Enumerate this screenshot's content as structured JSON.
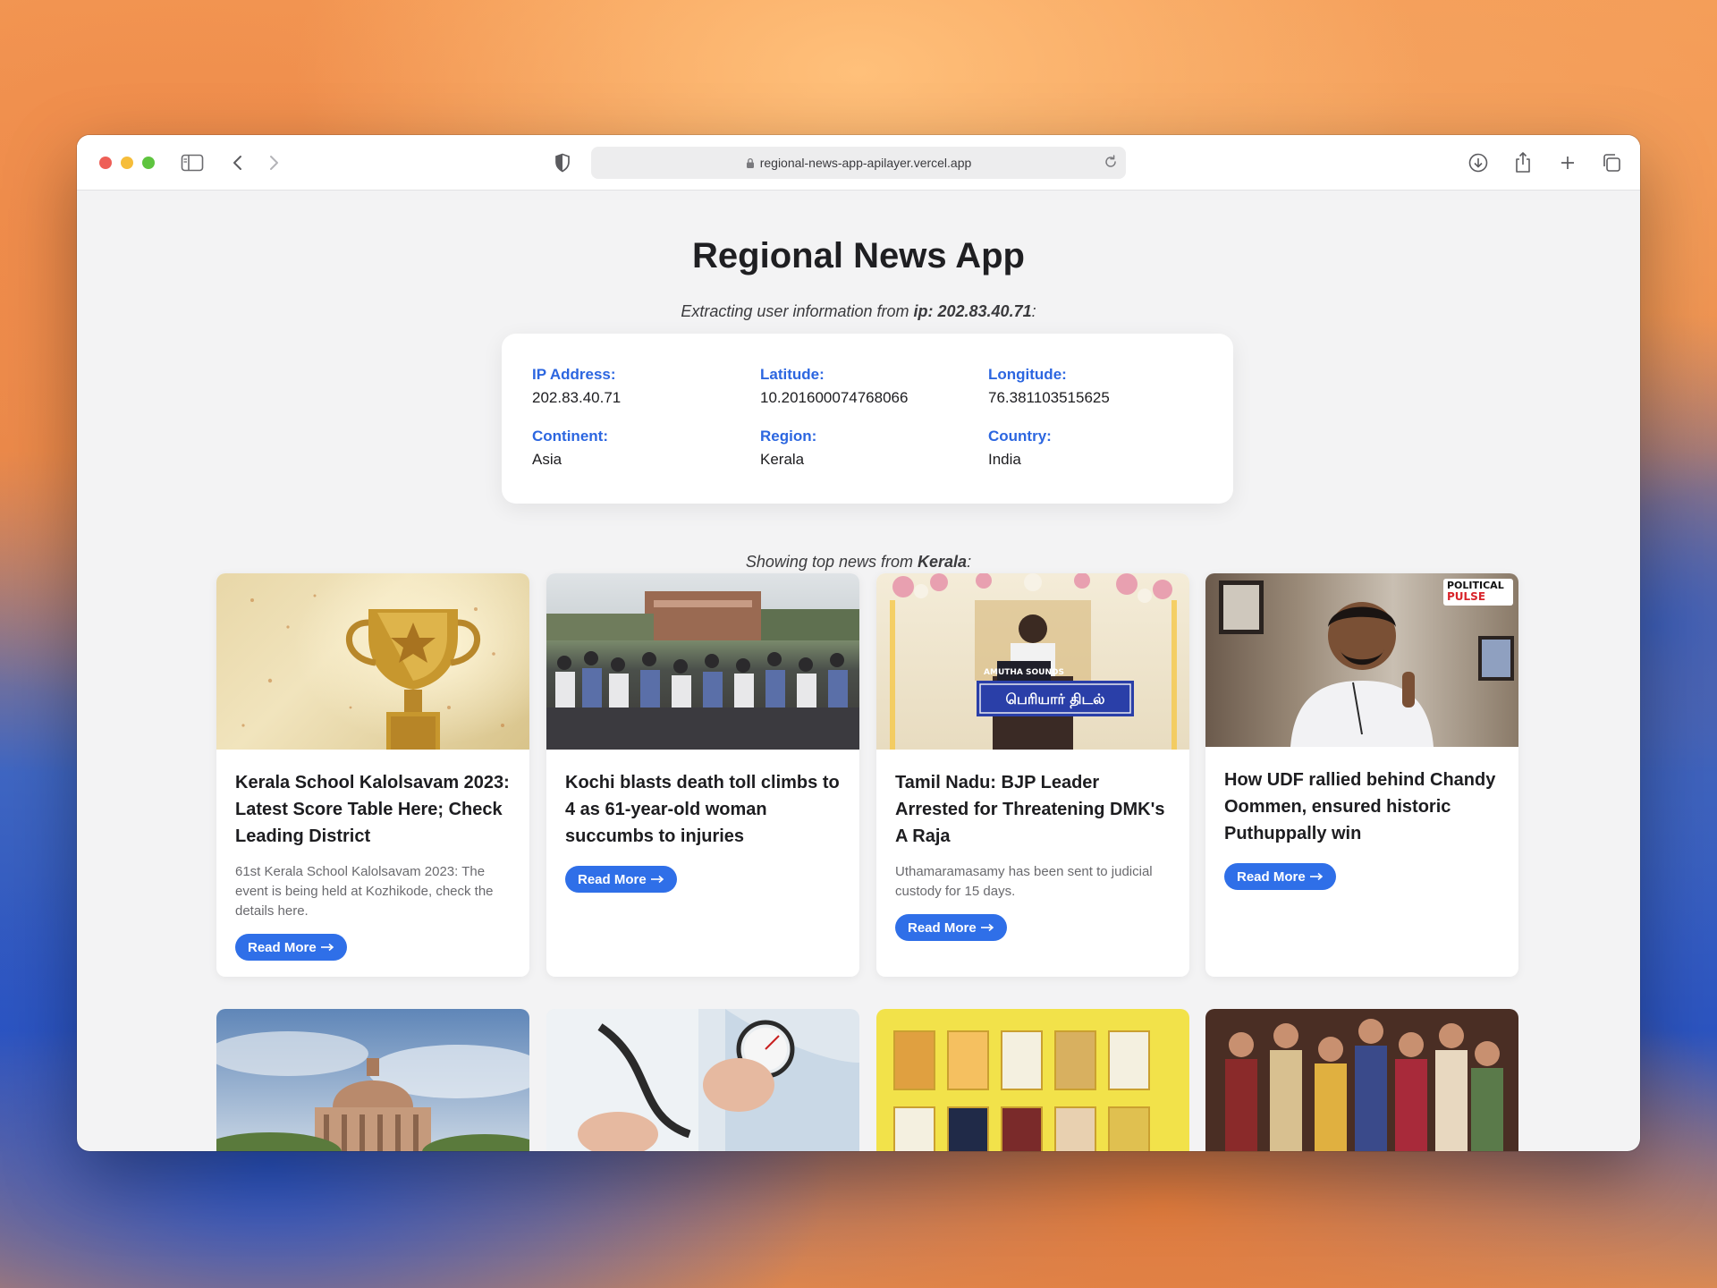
{
  "browser": {
    "url": "regional-news-app-apilayer.vercel.app"
  },
  "page": {
    "title": "Regional News App",
    "ip_intro": "Extracting user information from",
    "ip_label": "ip: 202.83.40.71",
    "ip_suffix": ":",
    "news_intro": "Showing top news from",
    "news_region": "Kerala",
    "news_suffix": ":"
  },
  "info": {
    "ip_label": "IP Address:",
    "ip_value": "202.83.40.71",
    "lat_label": "Latitude:",
    "lat_value": "10.201600074768066",
    "lon_label": "Longitude:",
    "lon_value": "76.381103515625",
    "continent_label": "Continent:",
    "continent_value": "Asia",
    "region_label": "Region:",
    "region_value": "Kerala",
    "country_label": "Country:",
    "country_value": "India"
  },
  "cards": [
    {
      "title": "Kerala School Kalolsavam 2023: Latest Score Table Here; Check Leading District",
      "desc": "61st Kerala School Kalolsavam 2023: The event is being held at Kozhikode, check the details here.",
      "button": "Read More",
      "image": "trophy-image"
    },
    {
      "title": "Kochi blasts death toll climbs to 4 as 61-year-old woman succumbs to injuries",
      "desc": "",
      "button": "Read More",
      "image": "crowd-image"
    },
    {
      "title": "Tamil Nadu: BJP Leader Arrested for Threatening DMK's A Raja",
      "desc": "Uthamaramasamy has been sent to judicial custody for 15 days.",
      "button": "Read More",
      "image": "speaker-podium-image",
      "podium_sign": "AMUTHA SOUNDS",
      "banner_text": "பெரியார் திடல்"
    },
    {
      "title": "How UDF rallied behind Chandy Oommen, ensured historic Puthuppally win",
      "desc": "",
      "button": "Read More",
      "image": "politician-portrait-image",
      "badge_line1": "POLITICAL",
      "badge_line2": "PULSE"
    }
  ],
  "bottom_cards": [
    {
      "image": "supreme-court-image"
    },
    {
      "image": "blood-pressure-image"
    },
    {
      "image": "books-image"
    },
    {
      "image": "painting-women-image"
    }
  ],
  "colors": {
    "accent": "#2f6fe8",
    "label_blue": "#2c66e0",
    "page_bg": "#f3f3f4"
  }
}
